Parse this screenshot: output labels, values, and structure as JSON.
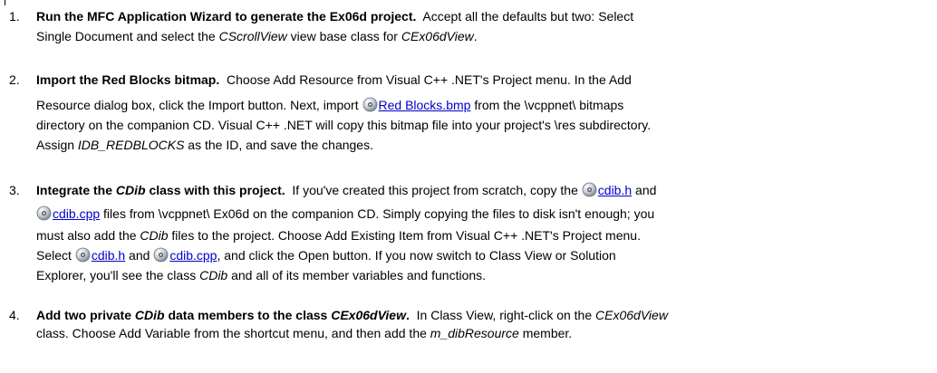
{
  "steps": [
    {
      "number": "1.",
      "lines": [
        [
          {
            "t": "b",
            "v": "Run the MFC Application Wizard to generate the Ex06d project."
          },
          {
            "t": "s",
            "v": "  Accept all the defaults but two: Select"
          }
        ],
        [
          {
            "t": "s",
            "v": "Single Document and select the "
          },
          {
            "t": "i",
            "v": "CScrollView"
          },
          {
            "t": "s",
            "v": " view base class for "
          },
          {
            "t": "i",
            "v": "CEx06dView"
          },
          {
            "t": "s",
            "v": "."
          }
        ]
      ]
    },
    {
      "number": "2.",
      "lines": [
        [
          {
            "t": "b",
            "v": "Import the Red Blocks bitmap."
          },
          {
            "t": "s",
            "v": "  Choose Add Resource from Visual C++ .NET's Project menu. In the Add"
          }
        ],
        [
          {
            "t": "s",
            "v": "Resource dialog box, click the Import button. Next, import "
          },
          {
            "t": "icon",
            "v": "cd-icon"
          },
          {
            "t": "link",
            "v": "Red Blocks.bmp"
          },
          {
            "t": "s",
            "v": " from the \\vcppnet\\ bitmaps"
          }
        ],
        [
          {
            "t": "s",
            "v": "directory on the companion CD. Visual C++ .NET will copy this bitmap file into your project's \\res subdirectory."
          }
        ],
        [
          {
            "t": "s",
            "v": "Assign "
          },
          {
            "t": "i",
            "v": "IDB_REDBLOCKS"
          },
          {
            "t": "s",
            "v": " as the ID, and save the changes."
          }
        ]
      ]
    },
    {
      "number": "3.",
      "lines": [
        [
          {
            "t": "b",
            "v": "Integrate the "
          },
          {
            "t": "bi",
            "v": "CDib"
          },
          {
            "t": "b",
            "v": " class with this project."
          },
          {
            "t": "s",
            "v": "  If you've created this project from scratch, copy the "
          },
          {
            "t": "icon",
            "v": "cd-icon"
          },
          {
            "t": "link",
            "v": "cdib.h"
          },
          {
            "t": "s",
            "v": " and"
          }
        ],
        [
          {
            "t": "icon",
            "v": "cd-icon"
          },
          {
            "t": "link",
            "v": "cdib.cpp"
          },
          {
            "t": "s",
            "v": " files from \\vcppnet\\ Ex06d on the companion CD. Simply copying the files to disk isn't enough; you"
          }
        ],
        [
          {
            "t": "s",
            "v": "must also add the "
          },
          {
            "t": "i",
            "v": "CDib"
          },
          {
            "t": "s",
            "v": " files to the project. Choose Add Existing Item from Visual C++ .NET's Project menu."
          }
        ],
        [
          {
            "t": "s",
            "v": "Select "
          },
          {
            "t": "icon",
            "v": "cd-icon"
          },
          {
            "t": "link",
            "v": "cdib.h"
          },
          {
            "t": "s",
            "v": " and "
          },
          {
            "t": "icon",
            "v": "cd-icon"
          },
          {
            "t": "link",
            "v": "cdib.cpp"
          },
          {
            "t": "s",
            "v": ", and click the Open button. If you now switch to Class View or Solution"
          }
        ],
        [
          {
            "t": "s",
            "v": "Explorer, you'll see the class "
          },
          {
            "t": "i",
            "v": "CDib"
          },
          {
            "t": "s",
            "v": " and all of its member variables and functions."
          }
        ]
      ]
    },
    {
      "number": "4.",
      "lines": [
        [
          {
            "t": "b",
            "v": "Add two private "
          },
          {
            "t": "bi",
            "v": "CDib"
          },
          {
            "t": "b",
            "v": " data members to the class "
          },
          {
            "t": "bi",
            "v": "CEx06dView"
          },
          {
            "t": "b",
            "v": "."
          },
          {
            "t": "s",
            "v": "  In Class View, right-click on the "
          },
          {
            "t": "i",
            "v": "CEx06dView"
          }
        ],
        [
          {
            "t": "s",
            "v": "class. Choose Add Variable from the shortcut menu, and then add the "
          },
          {
            "t": "i",
            "v": "m_dibResource"
          },
          {
            "t": "s",
            "v": " member."
          }
        ]
      ]
    }
  ]
}
